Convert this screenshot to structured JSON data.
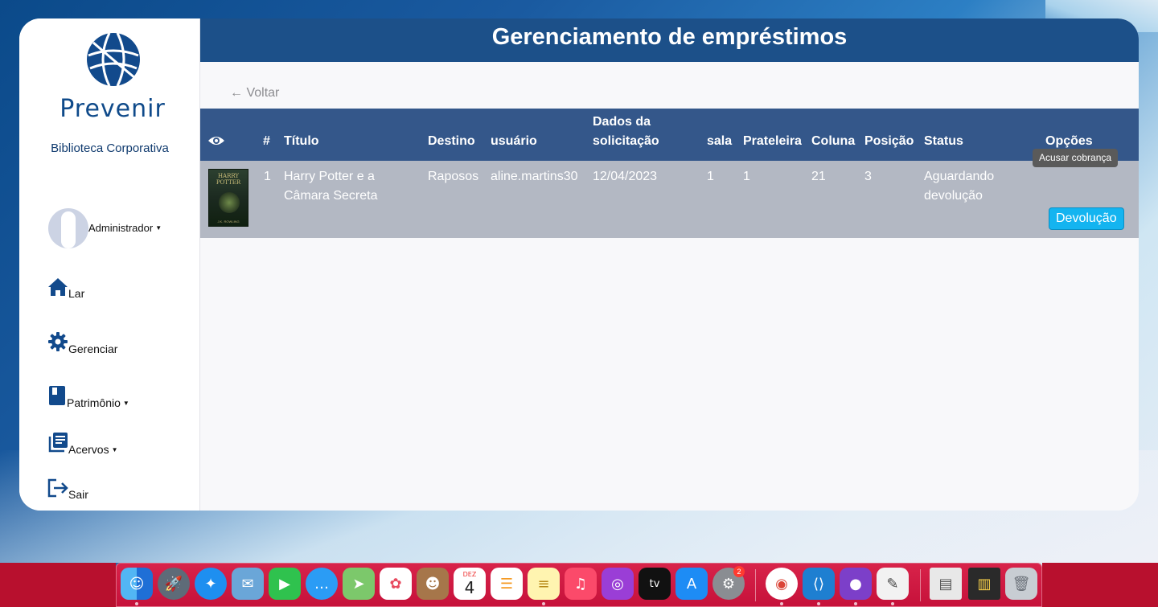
{
  "sidebar": {
    "logo_text": "Prevenir",
    "subtitle": "Biblioteca Corporativa",
    "user_name": "Administrador",
    "nav": [
      {
        "label": "Lar",
        "icon": "home-icon"
      },
      {
        "label": "Gerenciar",
        "icon": "gear-icon"
      },
      {
        "label": "Patrimônio",
        "icon": "book-icon"
      },
      {
        "label": "Acervos",
        "icon": "library-icon"
      },
      {
        "label": "Sair",
        "icon": "logout-icon"
      }
    ]
  },
  "header": {
    "title": "Gerenciamento de empréstimos"
  },
  "back_link": "← Voltar",
  "table": {
    "headers": {
      "eye": "eye-icon",
      "num": "#",
      "title": "Título",
      "destination": "Destino",
      "user": "usuário",
      "request_line1": "Dados da",
      "request_line2": "solicitação",
      "room": "sala",
      "shelf": "Prateleira",
      "column": "Coluna",
      "position": "Posição",
      "status": "Status",
      "options": "Opções"
    },
    "rows": [
      {
        "cover_title": "HARRY POTTER",
        "cover_author": "J.K. ROWLING",
        "num": "1",
        "title_line1": "Harry Potter e a",
        "title_line2": "Câmara Secreta",
        "destination": "Raposos",
        "user": "aline.martins30",
        "date": "12/04/2023",
        "room": "1",
        "shelf": "1",
        "column": "21",
        "position": "3",
        "status_line1": "Aguardando",
        "status_line2": "devolução",
        "button": "Devolução"
      }
    ]
  },
  "tooltip": "Acusar cobrança",
  "dock": {
    "calendar_month": "DEZ",
    "calendar_day": "4",
    "settings_badge": "2",
    "tv_label": "tv"
  },
  "colors": {
    "header_bg": "#1c5089",
    "table_header_bg": "#34578a",
    "row_bg": "#b3b8c3",
    "button_bg": "#14b4f0",
    "dock_bg": "#c6113a"
  }
}
